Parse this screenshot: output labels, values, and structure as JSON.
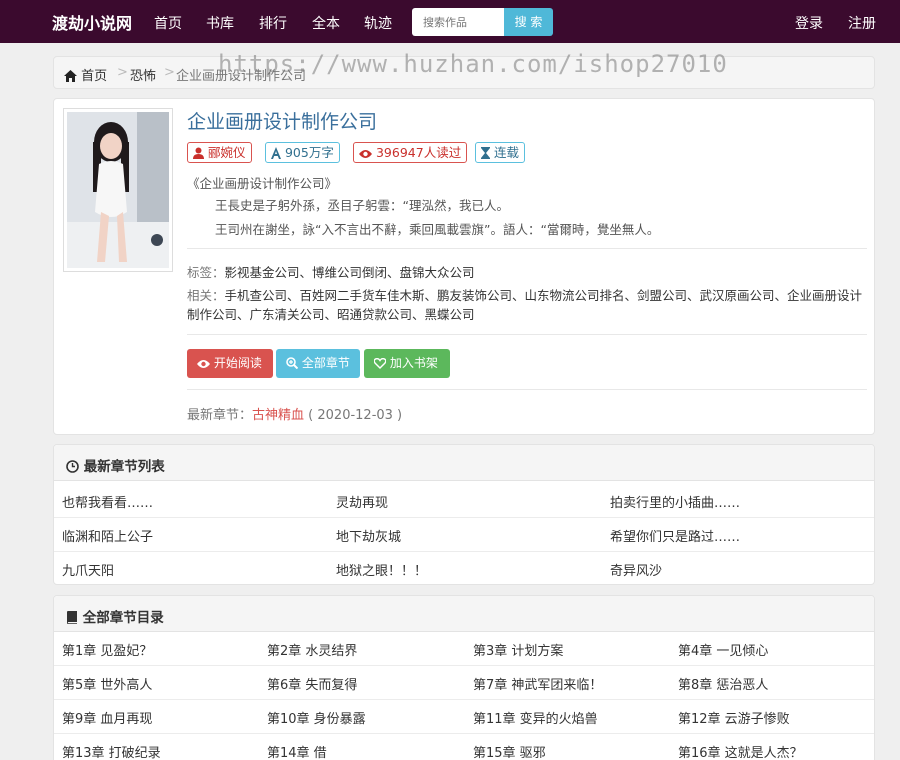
{
  "nav": {
    "brand": "渡劫小说网",
    "items": [
      "首页",
      "书库",
      "排行",
      "全本",
      "轨迹"
    ],
    "search_placeholder": "搜索作品",
    "search_button": "搜 索",
    "login": "登录",
    "register": "注册"
  },
  "watermark": "https://www.huzhan.com/ishop27010",
  "breadcrumb": {
    "home": "首页",
    "category": "恐怖",
    "current": "企业画册设计制作公司",
    "sep": ">"
  },
  "book": {
    "title": "企业画册设计制作公司",
    "author": "郦婉仪",
    "words": "905万字",
    "reads": "396947人读过",
    "status": "连载",
    "intro_title": "《企业画册设计制作公司》",
    "intro_lines": [
      "王長史是子躬外孫，丞目子躬雲：“理泓然，我已人。",
      "王司州在謝坐，詠“入不言出不辭，乘回風載雲旗”。語人：“當爾時，覺坐無人。"
    ],
    "tags_label": "标签：",
    "tags": "影视基金公司、博维公司倒闭、盘锦大众公司",
    "related_label": "相关：",
    "related": "手机查公司、百姓网二手货车佳木斯、鹏友装饰公司、山东物流公司排名、剑盟公司、武汉原画公司、企业画册设计制作公司、广东清关公司、昭通贷款公司、黑蝶公司",
    "btn_read": "开始阅读",
    "btn_all": "全部章节",
    "btn_shelf": "加入书架",
    "latest_label": "最新章节：",
    "latest_chapter": "古神精血",
    "latest_date": "( 2020-12-03 )"
  },
  "latest_list": {
    "title": "最新章节列表",
    "items": [
      "也帮我看看……",
      "灵劫再现",
      "拍卖行里的小插曲……",
      "临渊和陌上公子",
      "地下劫灰城",
      "希望你们只是路过……",
      "九爪天阳",
      "地狱之眼！！！",
      "奇异风沙"
    ]
  },
  "all_chapters": {
    "title": "全部章节目录",
    "items": [
      "第1章 见盈妃？",
      "第2章 水灵结界",
      "第3章 计划方案",
      "第4章 一见倾心",
      "第5章 世外高人",
      "第6章 失而复得",
      "第7章 神武军团来临！",
      "第8章 惩治恶人",
      "第9章 血月再现",
      "第10章 身份暴露",
      "第11章 变异的火焰兽",
      "第12章 云游子惨败",
      "第13章 打破纪录",
      "第14章 借",
      "第15章 驱邪",
      "第16章 这就是人杰？"
    ]
  },
  "colors": {
    "nav_bg": "#3b0a2e",
    "title_blue": "#3a6f9c",
    "red": "#d9534f",
    "info": "#5bc0de",
    "green": "#5cb85c"
  }
}
